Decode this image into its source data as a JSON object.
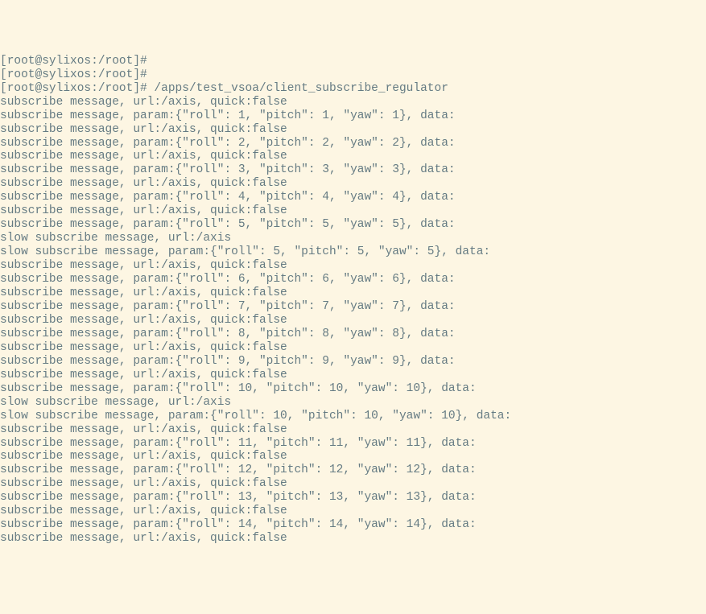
{
  "terminal": {
    "lines": [
      "[root@sylixos:/root]#",
      "[root@sylixos:/root]#",
      "[root@sylixos:/root]# /apps/test_vsoa/client_subscribe_regulator",
      "subscribe message, url:/axis, quick:false",
      "subscribe message, param:{\"roll\": 1, \"pitch\": 1, \"yaw\": 1}, data:",
      "subscribe message, url:/axis, quick:false",
      "subscribe message, param:{\"roll\": 2, \"pitch\": 2, \"yaw\": 2}, data:",
      "subscribe message, url:/axis, quick:false",
      "subscribe message, param:{\"roll\": 3, \"pitch\": 3, \"yaw\": 3}, data:",
      "subscribe message, url:/axis, quick:false",
      "subscribe message, param:{\"roll\": 4, \"pitch\": 4, \"yaw\": 4}, data:",
      "subscribe message, url:/axis, quick:false",
      "subscribe message, param:{\"roll\": 5, \"pitch\": 5, \"yaw\": 5}, data:",
      "slow subscribe message, url:/axis",
      "slow subscribe message, param:{\"roll\": 5, \"pitch\": 5, \"yaw\": 5}, data:",
      "subscribe message, url:/axis, quick:false",
      "subscribe message, param:{\"roll\": 6, \"pitch\": 6, \"yaw\": 6}, data:",
      "subscribe message, url:/axis, quick:false",
      "subscribe message, param:{\"roll\": 7, \"pitch\": 7, \"yaw\": 7}, data:",
      "subscribe message, url:/axis, quick:false",
      "subscribe message, param:{\"roll\": 8, \"pitch\": 8, \"yaw\": 8}, data:",
      "subscribe message, url:/axis, quick:false",
      "subscribe message, param:{\"roll\": 9, \"pitch\": 9, \"yaw\": 9}, data:",
      "subscribe message, url:/axis, quick:false",
      "subscribe message, param:{\"roll\": 10, \"pitch\": 10, \"yaw\": 10}, data:",
      "slow subscribe message, url:/axis",
      "slow subscribe message, param:{\"roll\": 10, \"pitch\": 10, \"yaw\": 10}, data:",
      "subscribe message, url:/axis, quick:false",
      "subscribe message, param:{\"roll\": 11, \"pitch\": 11, \"yaw\": 11}, data:",
      "subscribe message, url:/axis, quick:false",
      "subscribe message, param:{\"roll\": 12, \"pitch\": 12, \"yaw\": 12}, data:",
      "subscribe message, url:/axis, quick:false",
      "subscribe message, param:{\"roll\": 13, \"pitch\": 13, \"yaw\": 13}, data:",
      "subscribe message, url:/axis, quick:false",
      "subscribe message, param:{\"roll\": 14, \"pitch\": 14, \"yaw\": 14}, data:",
      "subscribe message, url:/axis, quick:false"
    ]
  }
}
